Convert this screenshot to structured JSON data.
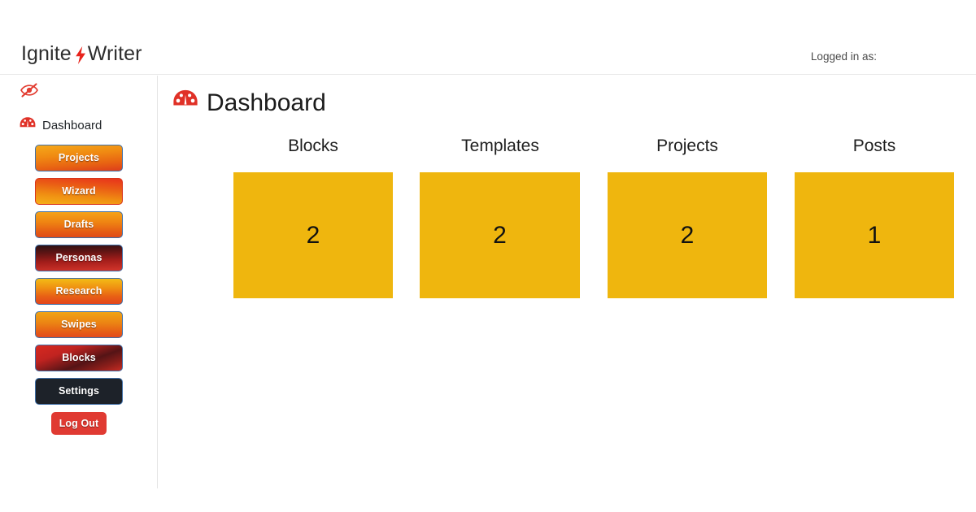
{
  "header": {
    "brand_part1": "Ignite",
    "brand_part2": "Writer",
    "bolt_icon": "lightning-bolt-icon",
    "logged_in_label": "Logged in as:",
    "logged_in_user": ""
  },
  "sidebar": {
    "visibility_icon": "eye-slash-icon",
    "dashboard_icon": "tachometer-icon",
    "dashboard_label": "Dashboard",
    "buttons": [
      {
        "label": "Projects",
        "style": "b-projects"
      },
      {
        "label": "Wizard",
        "style": "b-wizard"
      },
      {
        "label": "Drafts",
        "style": "b-drafts"
      },
      {
        "label": "Personas",
        "style": "b-personas"
      },
      {
        "label": "Research",
        "style": "b-research"
      },
      {
        "label": "Swipes",
        "style": "b-swipes"
      },
      {
        "label": "Blocks",
        "style": "b-blocks"
      },
      {
        "label": "Settings",
        "style": "b-settings"
      },
      {
        "label": "Log Out",
        "style": "b-logout"
      }
    ]
  },
  "main": {
    "title_icon": "tachometer-icon",
    "title": "Dashboard",
    "stats": [
      {
        "label": "Blocks",
        "value": "2"
      },
      {
        "label": "Templates",
        "value": "2"
      },
      {
        "label": "Projects",
        "value": "2"
      },
      {
        "label": "Posts",
        "value": "1"
      }
    ]
  },
  "colors": {
    "accent_red": "#e03a32",
    "stat_tile": "#efb60e",
    "brand_text": "#2e2e2e",
    "button_border_blue": "#3f6fa8",
    "settings_dark": "#1d2229"
  }
}
